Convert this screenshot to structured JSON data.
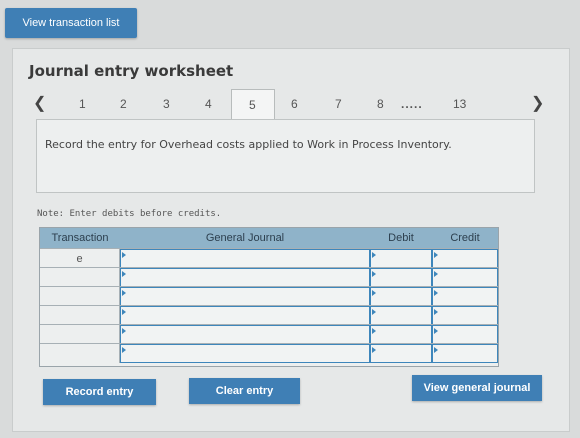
{
  "top": {
    "view_transaction_list": "View transaction list"
  },
  "panel": {
    "title": "Journal entry worksheet"
  },
  "pager": {
    "prev_icon": "chevron-left-icon",
    "next_icon": "chevron-right-icon",
    "pages": [
      "1",
      "2",
      "3",
      "4",
      "5",
      "6",
      "7",
      "8"
    ],
    "ellipsis": ".....",
    "last": "13",
    "active_page": "5"
  },
  "instruction": "Record the entry for Overhead costs applied to Work in Process Inventory.",
  "note": "Note: Enter debits before credits.",
  "table": {
    "headers": [
      "Transaction",
      "General Journal",
      "Debit",
      "Credit"
    ],
    "rows": [
      {
        "transaction": "e"
      },
      {
        "transaction": ""
      },
      {
        "transaction": ""
      },
      {
        "transaction": ""
      },
      {
        "transaction": ""
      },
      {
        "transaction": ""
      }
    ]
  },
  "buttons": {
    "record_entry": "Record entry",
    "clear_entry": "Clear entry",
    "view_general_journal": "View general journal"
  },
  "colors": {
    "button": "#3f7fb5",
    "header": "#8fb3c9",
    "cell_border": "#3e86bb"
  }
}
